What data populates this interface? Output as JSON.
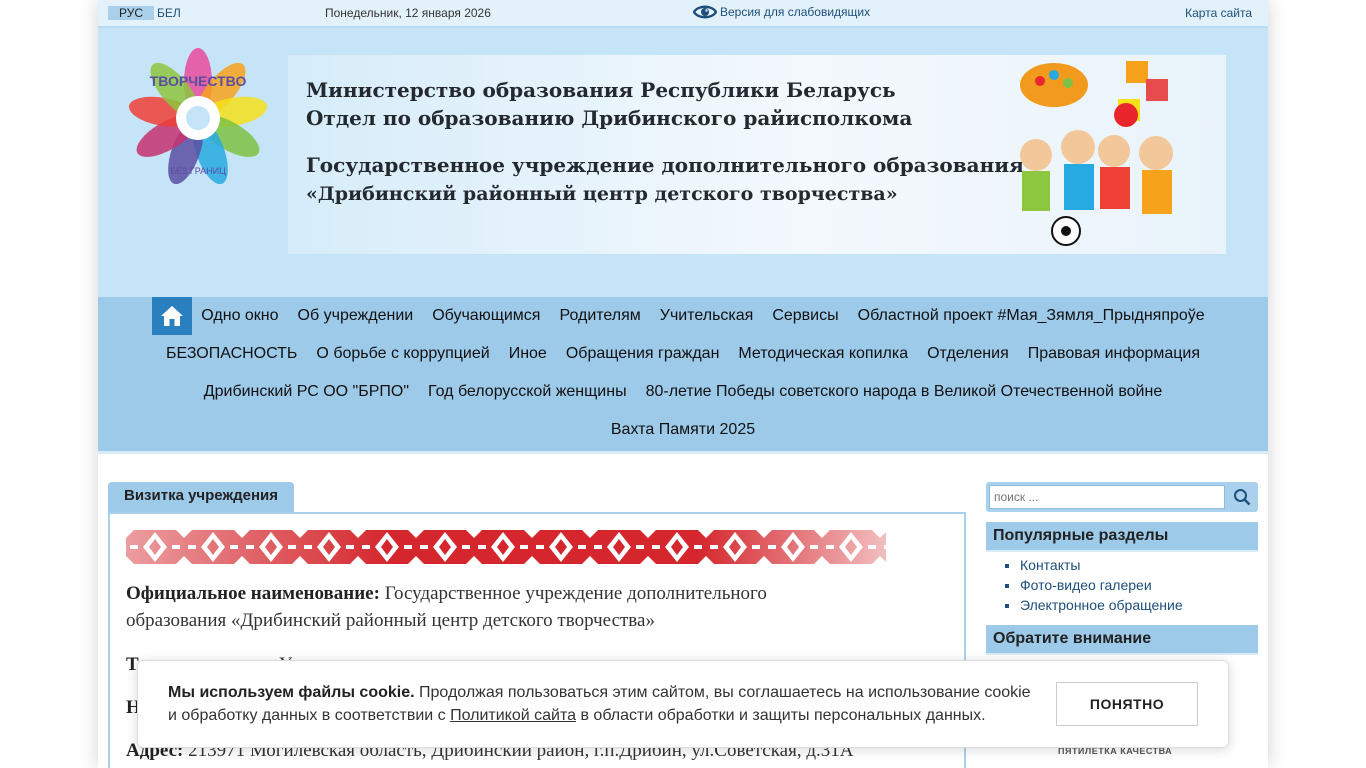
{
  "topbar": {
    "lang_ru": "РУС",
    "lang_be": "БЕЛ",
    "date": "Понедельник, 12 января 2026",
    "low_vision": "Версия для слабовидящих",
    "sitemap": "Карта сайта"
  },
  "header": {
    "logo_text": "ТВОРЧЕСТВО",
    "logo_subtext": "БЕЗ ГРАНИЦ",
    "banner_line1": "Министерство образования Республики Беларусь",
    "banner_line2": "Отдел по образованию Дрибинского райисполкома",
    "banner_line3": "Государственное учреждение дополнительного образования",
    "banner_line4": "«Дрибинский районный центр детского творчества»"
  },
  "nav": {
    "row1": [
      "Одно окно",
      "Об учреждении",
      "Обучающимся",
      "Родителям",
      "Учительская",
      "Сервисы",
      "Областной проект #Мая_Зямля_Прыдняпроўе"
    ],
    "row2": [
      "БЕЗОПАСНОСТЬ",
      "О борьбе с коррупцией",
      "Иное",
      "Обращения граждан",
      "Методическая копилка",
      "Отделения",
      "Правовая информация"
    ],
    "row3": [
      "Дрибинский РС ОО \"БРПО\"",
      "Год белорусской женщины",
      "80-летие Победы советского народа в Великой Отечественной войне"
    ],
    "row4": [
      "Вахта Памяти 2025"
    ]
  },
  "content": {
    "tab_title": "Визитка учреждения",
    "p1_label": "Официальное наименование:",
    "p1_text": " Государственное  учреждение дополнительного образования «Дрибинский районный центр детского творчества»",
    "p2_label": "Т",
    "p2_text": "У",
    "p3_label": "Н",
    "p4_label": "Адрес:",
    "p4_text": " 213971 Могилевская область, Дрибинский район, г.п.Дрибин, ул.Советская, д.31А"
  },
  "sidebar": {
    "search_placeholder": "поиск ...",
    "popular_title": "Популярные разделы",
    "popular_items": [
      "Контакты",
      "Фото-видео галереи",
      "Электронное обращение"
    ],
    "attention_title": "Обратите внимание",
    "quality_caption": "ПЯТИЛЕТКА КАЧЕСТВА"
  },
  "cookie": {
    "bold": "Мы используем файлы cookie.",
    "text1": " Продолжая пользоваться этим сайтом, вы соглашаетесь на использование cookie и обработку данных в соответствии с ",
    "link": "Политикой сайта",
    "text2": " в области обработки и защиты персональных данных.",
    "button": "ПОНЯТНО"
  },
  "colors": {
    "accent": "#2a7fbf",
    "nav_bg": "#9ecaea",
    "header_bg": "#c6e4f8",
    "ornament_red": "#d4262c"
  }
}
